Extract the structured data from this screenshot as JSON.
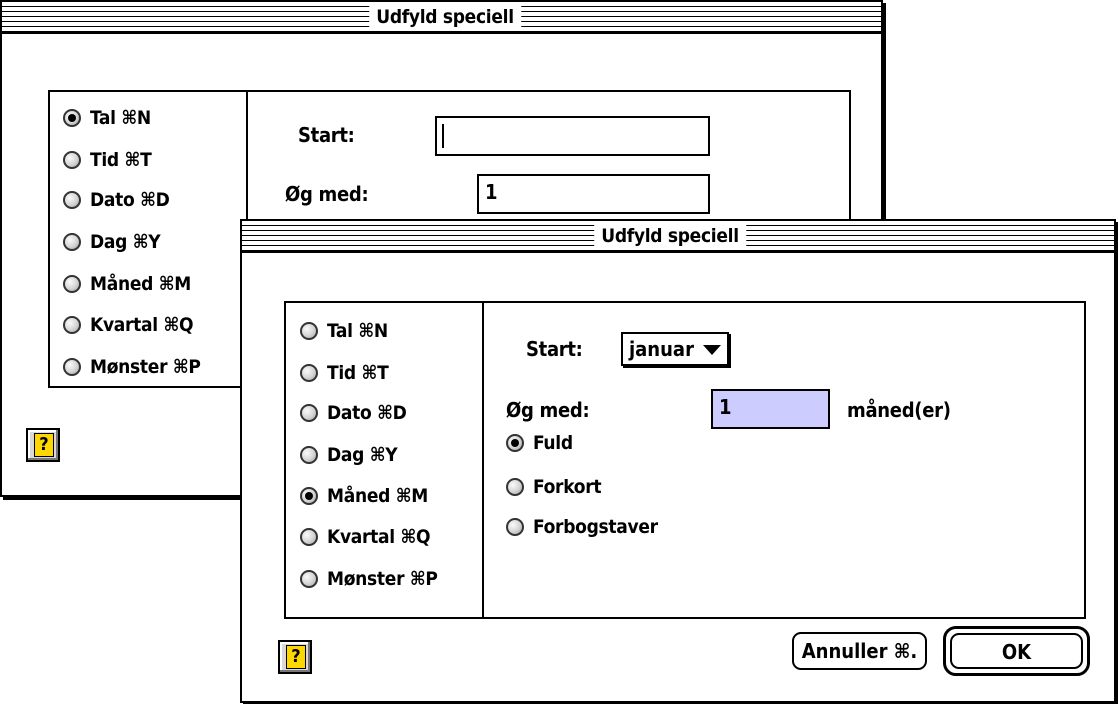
{
  "back_dialog": {
    "title": "Udfyld speciell",
    "radios": [
      {
        "label": "Tal ⌘N",
        "checked": true
      },
      {
        "label": "Tid ⌘T",
        "checked": false
      },
      {
        "label": "Dato ⌘D",
        "checked": false
      },
      {
        "label": "Dag ⌘Y",
        "checked": false
      },
      {
        "label": "Måned ⌘M",
        "checked": false
      },
      {
        "label": "Kvartal ⌘Q",
        "checked": false
      },
      {
        "label": "Mønster ⌘P",
        "checked": false
      }
    ],
    "start_label": "Start:",
    "start_value": "",
    "increment_label": "Øg med:",
    "increment_value": "1",
    "help_icon": "help-question-icon"
  },
  "front_dialog": {
    "title": "Udfyld speciell",
    "radios": [
      {
        "label": "Tal ⌘N",
        "checked": false
      },
      {
        "label": "Tid ⌘T",
        "checked": false
      },
      {
        "label": "Dato ⌘D",
        "checked": false
      },
      {
        "label": "Dag ⌘Y",
        "checked": false
      },
      {
        "label": "Måned ⌘M",
        "checked": true
      },
      {
        "label": "Kvartal ⌘Q",
        "checked": false
      },
      {
        "label": "Mønster ⌘P",
        "checked": false
      }
    ],
    "start_label": "Start:",
    "start_value": "januar",
    "increment_label": "Øg med:",
    "increment_value": "1",
    "increment_unit": "måned(er)",
    "format_options": [
      {
        "label": "Fuld",
        "checked": true
      },
      {
        "label": "Forkort",
        "checked": false
      },
      {
        "label": "Forbogstaver",
        "checked": false
      }
    ],
    "cancel_label": "Annuller ⌘.",
    "ok_label": "OK",
    "help_icon": "help-question-icon",
    "field_highlight_color": "#ccccff"
  }
}
